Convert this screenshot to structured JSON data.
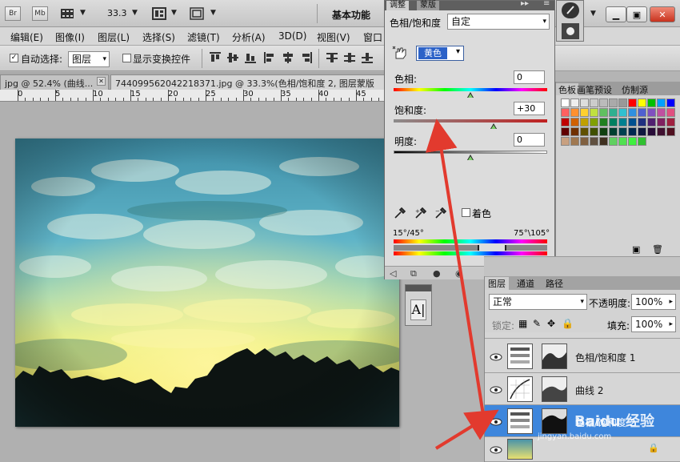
{
  "appbar": {
    "br": "Br",
    "mb": "Mb",
    "zoom": "33.3",
    "workspace": "基本功能"
  },
  "menu": [
    "编辑(E)",
    "图像(I)",
    "图层(L)",
    "选择(S)",
    "滤镜(T)",
    "分析(A)",
    "3D(D)",
    "视图(V)",
    "窗口"
  ],
  "options": {
    "auto_select_label": "自动选择:",
    "auto_select_checked": true,
    "auto_select_value": "图层",
    "show_transform_label": "显示变换控件",
    "show_transform_checked": false
  },
  "tabs": {
    "tab1": "jpg @ 52.4% (曲线...",
    "tab2": "744099562042218371.jpg @ 33.3%(色相/饱和度 2, 图层蒙版"
  },
  "ruler": [
    "0",
    "5",
    "10",
    "15",
    "20",
    "25",
    "30",
    "35",
    "40",
    "45"
  ],
  "adjustments": {
    "tab_active": "调整",
    "tab_other": "蒙版",
    "title": "色相/饱和度",
    "preset": "自定",
    "edit_channel": "黄色",
    "hue_label": "色相:",
    "hue": "0",
    "hue_value": 0,
    "saturation_label": "饱和度:",
    "saturation": "+30",
    "saturation_value": 30,
    "lightness_label": "明度:",
    "lightness": "0",
    "lightness_value": 0,
    "colorize_label": "着色",
    "colorize_checked": false,
    "range_left": "15°/45°",
    "range_right": "75°\\105°"
  },
  "swatches": {
    "tabs": [
      "色板",
      "画笔预设",
      "仿制源"
    ]
  },
  "layers": {
    "tabs": [
      "图层",
      "通道",
      "路径"
    ],
    "blend_mode": "正常",
    "opacity_label": "不透明度:",
    "opacity": "100%",
    "lock_label": "锁定:",
    "fill_label": "填充:",
    "fill": "100%",
    "items": [
      {
        "name": "色相/饱和度 1"
      },
      {
        "name": "曲线 2"
      },
      {
        "name": "色相/饱和度 2"
      },
      {
        "name": ""
      }
    ]
  },
  "colors": {
    "selection": "#3e86dc",
    "annotation_arrow": "#e23a2e"
  },
  "watermark": {
    "site": "jingyan.baidu.com",
    "brand": "Baidu 经验"
  }
}
